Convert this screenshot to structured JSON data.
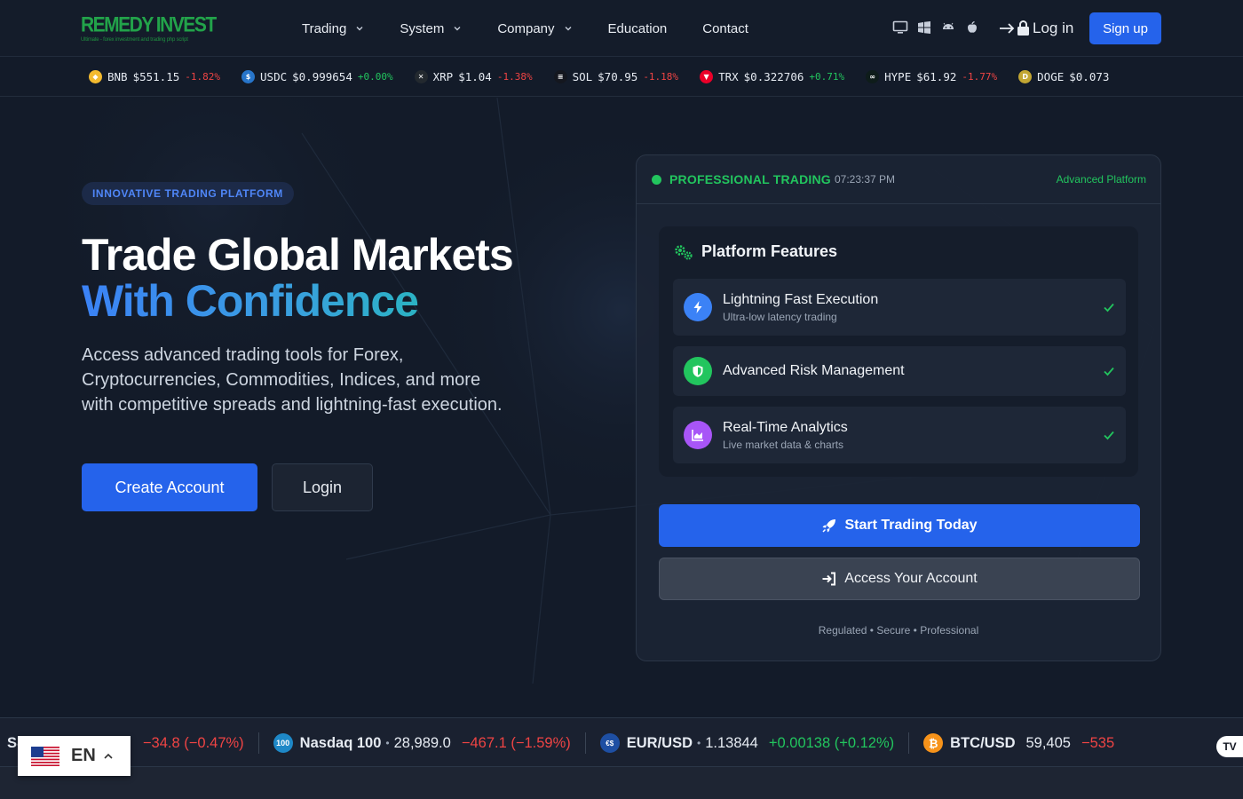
{
  "brand": {
    "name": "REMEDY INVEST",
    "tagline": "Ultimate - forex investment and trading php script"
  },
  "nav": {
    "items": [
      {
        "label": "Trading",
        "has_dropdown": true
      },
      {
        "label": "System",
        "has_dropdown": true
      },
      {
        "label": "Company",
        "has_dropdown": true
      },
      {
        "label": "Education",
        "has_dropdown": false
      },
      {
        "label": "Contact",
        "has_dropdown": false
      }
    ],
    "device_icons": [
      "desktop-icon",
      "windows-icon",
      "android-icon",
      "apple-icon"
    ],
    "login_label": "Log in",
    "signup_label": "Sign up"
  },
  "ticker": [
    {
      "symbol": "BNB",
      "price": "$551.15",
      "change": "-1.82%",
      "dir": "neg",
      "color": "#f3ba2f"
    },
    {
      "symbol": "USDC",
      "price": "$0.999654",
      "change": "+0.00%",
      "dir": "pos",
      "color": "#2775ca"
    },
    {
      "symbol": "XRP",
      "price": "$1.04",
      "change": "-1.38%",
      "dir": "neg",
      "color": "#23292f"
    },
    {
      "symbol": "SOL",
      "price": "$70.95",
      "change": "-1.18%",
      "dir": "neg",
      "color": "#14171f"
    },
    {
      "symbol": "TRX",
      "price": "$0.322706",
      "change": "+0.71%",
      "dir": "pos",
      "color": "#eb0029"
    },
    {
      "symbol": "HYPE",
      "price": "$61.92",
      "change": "-1.77%",
      "dir": "neg",
      "color": "#0e1c1a"
    },
    {
      "symbol": "DOGE",
      "price": "$0.073",
      "change": "",
      "dir": "neg",
      "color": "#c2a633"
    }
  ],
  "hero": {
    "badge": "INNOVATIVE TRADING PLATFORM",
    "title_line1": "Trade Global Markets",
    "title_line2": "With Confidence",
    "lead": "Access advanced trading tools for Forex, Cryptocurrencies, Commodities, Indices, and more with competitive spreads and lightning-fast execution.",
    "create_label": "Create Account",
    "login_label": "Login"
  },
  "card": {
    "status_label": "PROFESSIONAL TRADING",
    "time": "07:23:37 PM",
    "right_label": "Advanced Platform",
    "features_title": "Platform Features",
    "features": [
      {
        "title": "Lightning Fast Execution",
        "subtitle": "Ultra-low latency trading",
        "icon": "bolt-icon",
        "color": "#3b82f6"
      },
      {
        "title": "Advanced Risk Management",
        "subtitle": "",
        "icon": "shield-icon",
        "color": "#22c55e"
      },
      {
        "title": "Real-Time Analytics",
        "subtitle": "Live market data & charts",
        "icon": "chart-icon",
        "color": "#a855f7"
      }
    ],
    "start_label": "Start Trading Today",
    "access_label": "Access Your Account",
    "footnote": "Regulated • Secure • Professional"
  },
  "bottom_ticker": [
    {
      "symbol": "",
      "price": "",
      "change": "−34.8 (−0.47%)",
      "dir": "neg",
      "partial": "S&",
      "icon": ""
    },
    {
      "symbol": "Nasdaq 100",
      "price": "28,989.0",
      "change": "−467.1 (−1.59%)",
      "dir": "neg",
      "icon": "100",
      "icon_color": "#1e88c7"
    },
    {
      "symbol": "EUR/USD",
      "price": "1.13844",
      "change": "+0.00138 (+0.12%)",
      "dir": "pos",
      "icon": "€$",
      "icon_color": "#1e4fa3"
    },
    {
      "symbol": "BTC/USD",
      "price": "59,405",
      "change": "−535",
      "dir": "neg",
      "icon": "₿",
      "icon_color": "#f7931a",
      "price_dir": "pos"
    }
  ],
  "language": {
    "code": "EN"
  },
  "colors": {
    "accent": "#2563eb",
    "positive": "#22c55e",
    "negative": "#ef4444",
    "background": "#131b29"
  }
}
